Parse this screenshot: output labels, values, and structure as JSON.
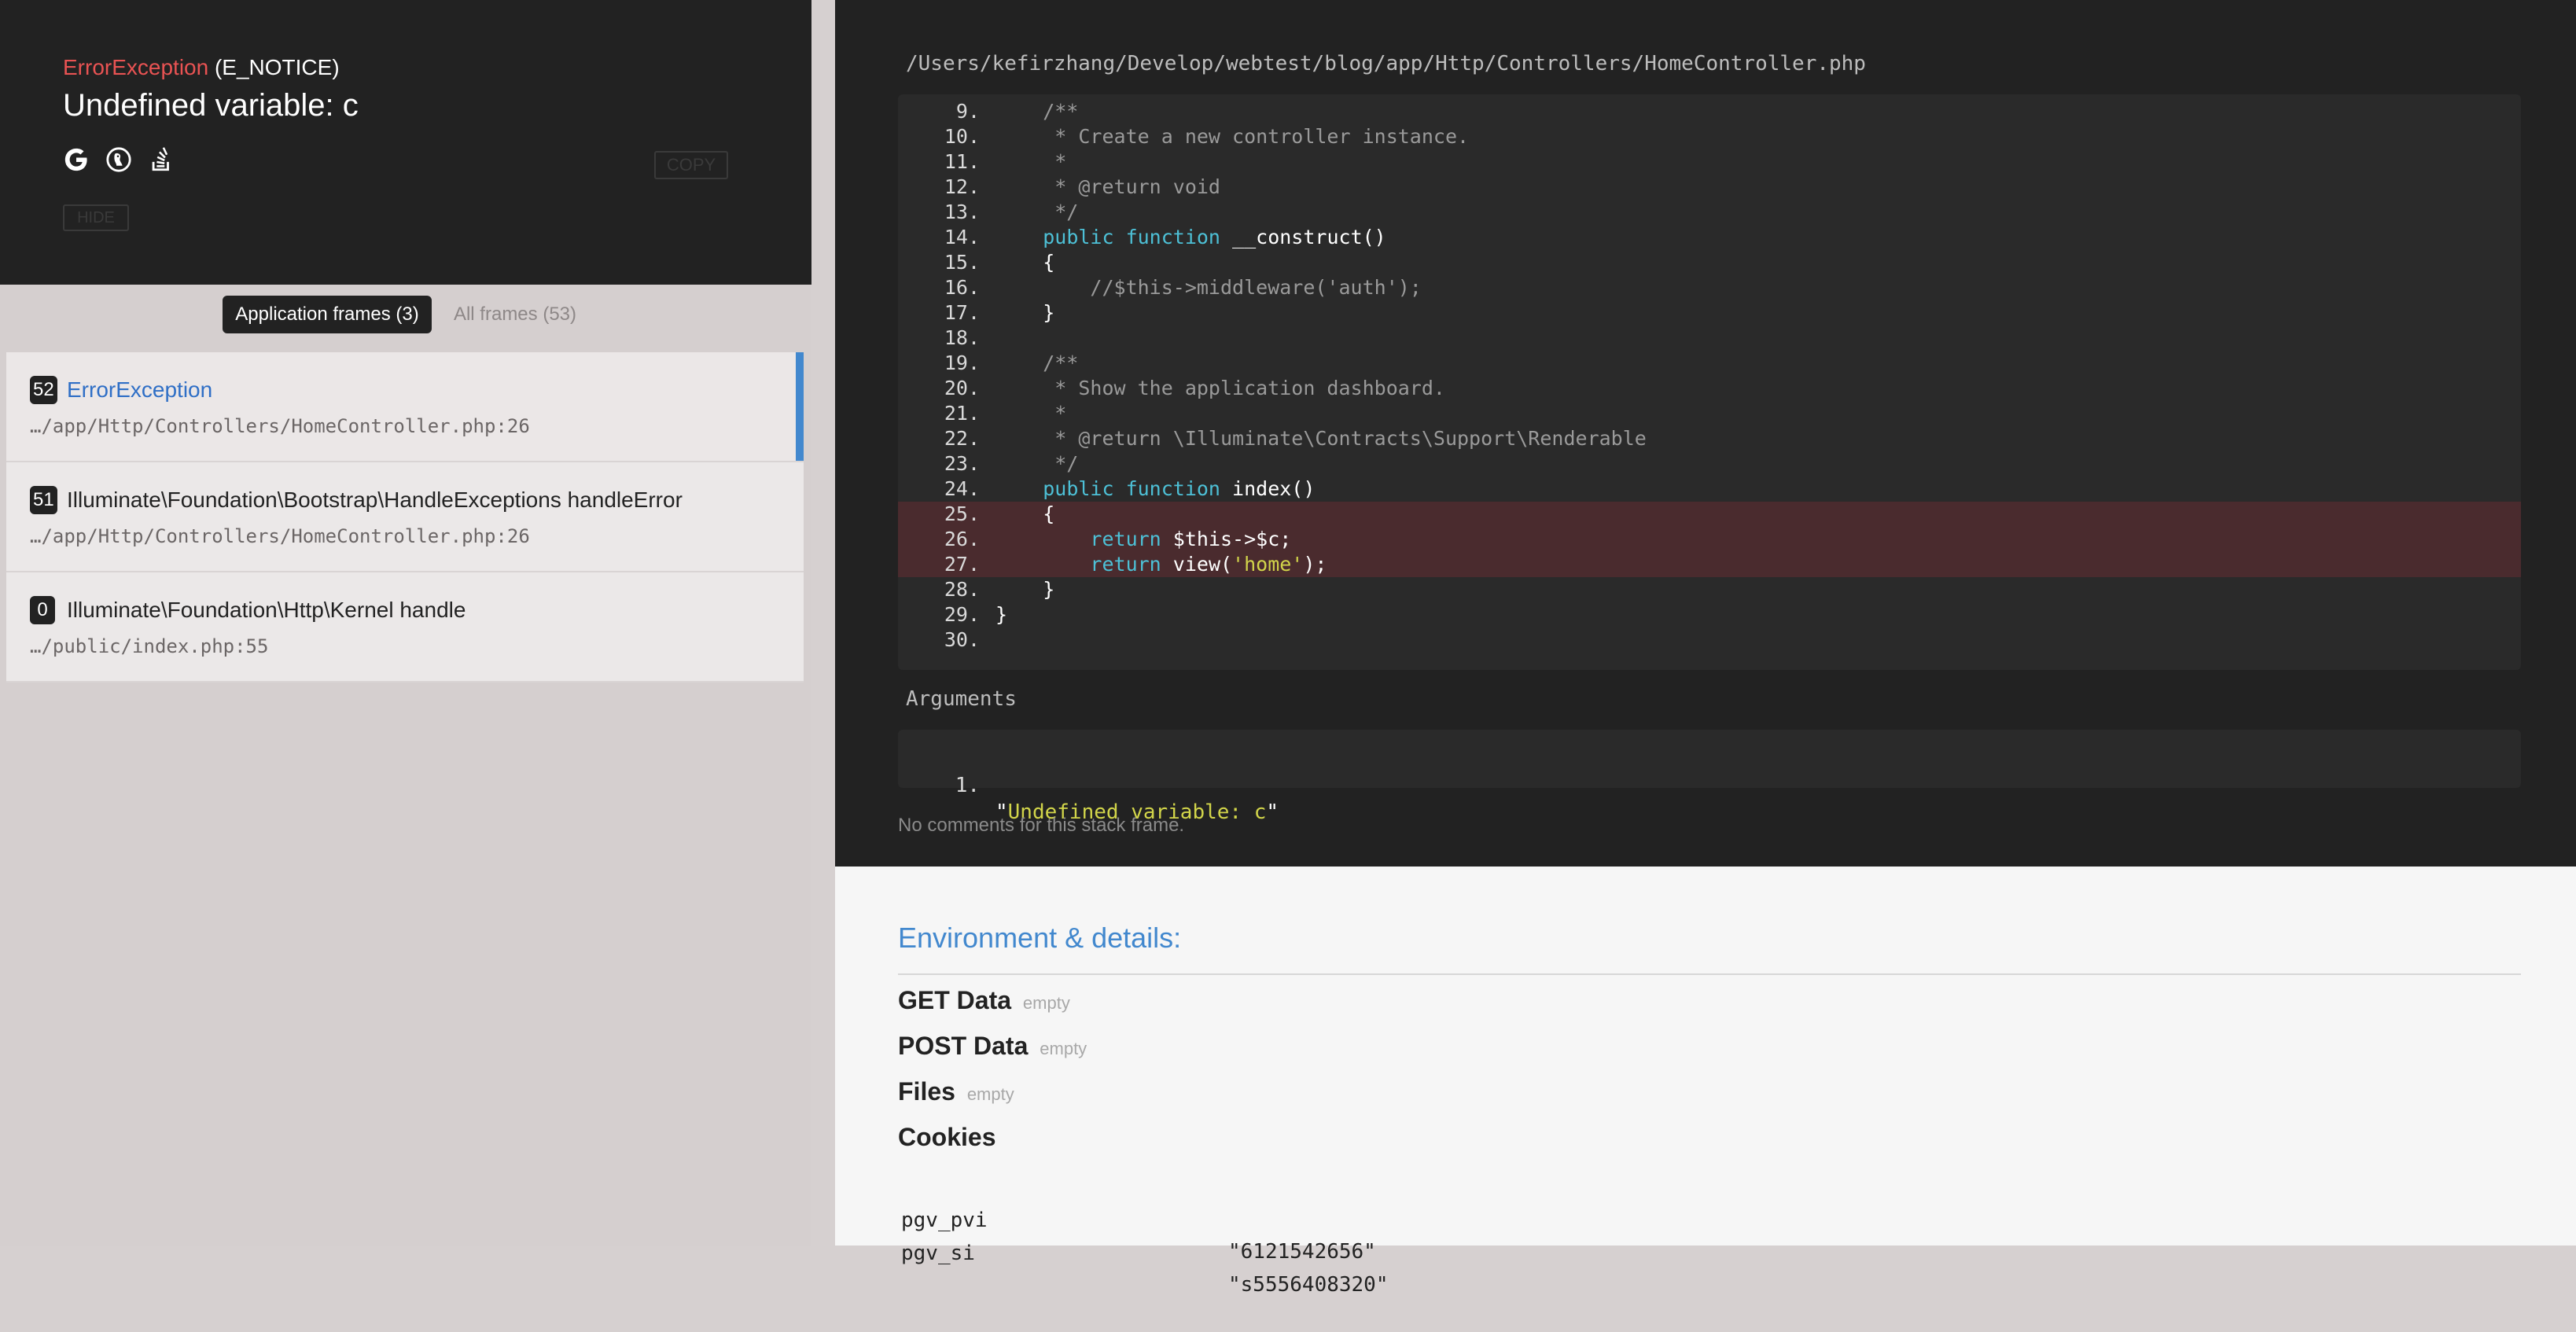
{
  "header": {
    "exception_class": "ErrorException",
    "exception_code": "(E_NOTICE)",
    "message": "Undefined variable: c",
    "copy_label": "COPY",
    "hide_label": "HIDE",
    "search_icons": [
      "google-icon",
      "duckduckgo-icon",
      "stackoverflow-icon"
    ]
  },
  "filters": {
    "app_frames": "Application frames (3)",
    "all_frames": "All frames (53)"
  },
  "frames": [
    {
      "index": "52",
      "class": "ErrorException",
      "file": "…/app/Http/Controllers/HomeController.php:26"
    },
    {
      "index": "51",
      "class": "Illuminate\\Foundation\\Bootstrap\\HandleExceptions handleError",
      "file": "…/app/Http/Controllers/HomeController.php:26"
    },
    {
      "index": "0",
      "class": "Illuminate\\Foundation\\Http\\Kernel handle",
      "file": "…/public/index.php:55"
    }
  ],
  "code": {
    "file_path": "/Users/kefirzhang/Develop/webtest/blog/app/Http/Controllers/HomeController.php",
    "highlight_lines": [
      "25",
      "26",
      "27"
    ],
    "lines": [
      {
        "n": "9.",
        "tokens": [
          {
            "t": "    /**",
            "c": "com"
          }
        ]
      },
      {
        "n": "10.",
        "tokens": [
          {
            "t": "     * Create a new controller instance.",
            "c": "com"
          }
        ]
      },
      {
        "n": "11.",
        "tokens": [
          {
            "t": "     *",
            "c": "com"
          }
        ]
      },
      {
        "n": "12.",
        "tokens": [
          {
            "t": "     * @return void",
            "c": "com"
          }
        ]
      },
      {
        "n": "13.",
        "tokens": [
          {
            "t": "     */",
            "c": "com"
          }
        ]
      },
      {
        "n": "14.",
        "tokens": [
          {
            "t": "    ",
            "c": ""
          },
          {
            "t": "public function",
            "c": "kw"
          },
          {
            "t": " __construct()",
            "c": ""
          }
        ]
      },
      {
        "n": "15.",
        "tokens": [
          {
            "t": "    {",
            "c": ""
          }
        ]
      },
      {
        "n": "16.",
        "tokens": [
          {
            "t": "        //$this->middleware('auth');",
            "c": "com"
          }
        ]
      },
      {
        "n": "17.",
        "tokens": [
          {
            "t": "    }",
            "c": ""
          }
        ]
      },
      {
        "n": "18.",
        "tokens": []
      },
      {
        "n": "19.",
        "tokens": [
          {
            "t": "    /**",
            "c": "com"
          }
        ]
      },
      {
        "n": "20.",
        "tokens": [
          {
            "t": "     * Show the application dashboard.",
            "c": "com"
          }
        ]
      },
      {
        "n": "21.",
        "tokens": [
          {
            "t": "     *",
            "c": "com"
          }
        ]
      },
      {
        "n": "22.",
        "tokens": [
          {
            "t": "     * @return \\Illuminate\\Contracts\\Support\\Renderable",
            "c": "com"
          }
        ]
      },
      {
        "n": "23.",
        "tokens": [
          {
            "t": "     */",
            "c": "com"
          }
        ]
      },
      {
        "n": "24.",
        "tokens": [
          {
            "t": "    ",
            "c": ""
          },
          {
            "t": "public function",
            "c": "kw"
          },
          {
            "t": " index()",
            "c": ""
          }
        ]
      },
      {
        "n": "25.",
        "tokens": [
          {
            "t": "    {",
            "c": ""
          }
        ]
      },
      {
        "n": "26.",
        "tokens": [
          {
            "t": "        ",
            "c": ""
          },
          {
            "t": "return",
            "c": "kw"
          },
          {
            "t": " $this->$c;",
            "c": ""
          }
        ]
      },
      {
        "n": "27.",
        "tokens": [
          {
            "t": "        ",
            "c": ""
          },
          {
            "t": "return",
            "c": "kw"
          },
          {
            "t": " view(",
            "c": ""
          },
          {
            "t": "'home'",
            "c": "str"
          },
          {
            "t": ");",
            "c": ""
          }
        ]
      },
      {
        "n": "28.",
        "tokens": [
          {
            "t": "    }",
            "c": ""
          }
        ]
      },
      {
        "n": "29.",
        "tokens": [
          {
            "t": "}",
            "c": ""
          }
        ]
      },
      {
        "n": "30.",
        "tokens": []
      }
    ]
  },
  "arguments": {
    "title": "Arguments",
    "items": [
      {
        "n": "1.",
        "value": "Undefined variable: c"
      }
    ]
  },
  "no_comments": "No comments for this stack frame.",
  "environment": {
    "title": "Environment & details:",
    "empty_label": "empty",
    "get_data": "GET Data",
    "post_data": "POST Data",
    "files": "Files",
    "cookies": "Cookies",
    "cookie_rows": [
      {
        "key": "pgv_pvi",
        "value": "\"6121542656\""
      },
      {
        "key": "pgv_si",
        "value": "\"s5556408320\""
      }
    ]
  },
  "colors": {
    "accent": "#4288ce",
    "exception": "#e95353",
    "keyword": "#4dc0d6",
    "string": "#d2d54a",
    "highlight": "#4a2b2e"
  }
}
